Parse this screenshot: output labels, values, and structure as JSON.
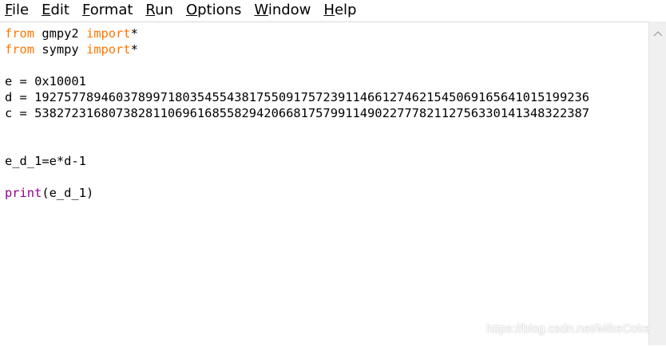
{
  "menu": [
    {
      "key": "F",
      "rest": "ile"
    },
    {
      "key": "E",
      "rest": "dit"
    },
    {
      "key": "F",
      "rest": "ormat",
      "prefix": ""
    },
    {
      "key": "R",
      "rest": "un"
    },
    {
      "key": "O",
      "rest": "ptions"
    },
    {
      "key": "W",
      "rest": "indow"
    },
    {
      "key": "H",
      "rest": "elp"
    }
  ],
  "code": {
    "line1": {
      "kw1": "from",
      "mod": " gmpy2 ",
      "kw2": "import",
      "rest": "*"
    },
    "line2": {
      "kw1": "from",
      "mod": " sympy ",
      "kw2": "import",
      "rest": "*"
    },
    "line4": "e = 0x10001",
    "line5": "d = 192757789460378997180354554381755091757239114661274621545069165641015199236",
    "line6": "c = 538272316807382811069616855829420668175799114902277782112756330141348322387",
    "line9": "e_d_1=e*d-1",
    "line11": {
      "builtin": "print",
      "rest": "(e_d_1)"
    }
  },
  "watermark": "https://blog.csdn.net/MikeCoke",
  "colors": {
    "keyword": "#ff7700",
    "builtin": "#900090"
  }
}
